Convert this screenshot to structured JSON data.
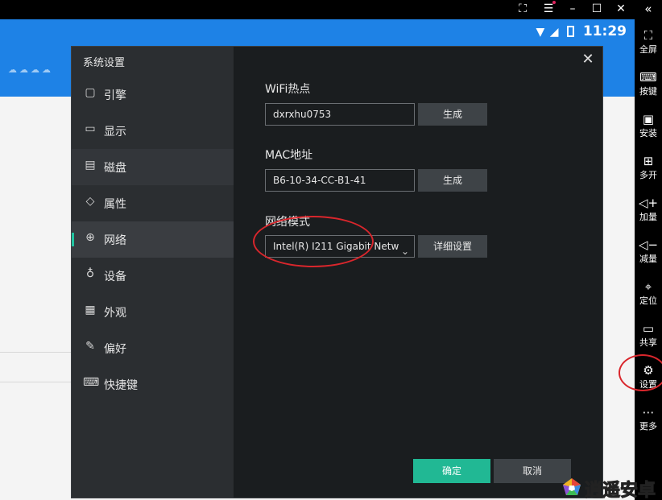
{
  "window_controls": {
    "screenshot": "⛶",
    "menu": "☰",
    "minimize": "–",
    "maximize": "☐",
    "close": "✕",
    "collapse": "«"
  },
  "statusbar": {
    "time": "11:29"
  },
  "right_toolbar": {
    "items": [
      {
        "icon": "⛶",
        "label": "全屏"
      },
      {
        "icon": "⌨",
        "label": "按键"
      },
      {
        "icon": "▣",
        "label": "安装"
      },
      {
        "icon": "⊞",
        "label": "多开"
      },
      {
        "icon": "◁+",
        "label": "加量"
      },
      {
        "icon": "◁−",
        "label": "减量"
      },
      {
        "icon": "⌖",
        "label": "定位"
      },
      {
        "icon": "▭",
        "label": "共享"
      },
      {
        "icon": "⚙",
        "label": "设置"
      },
      {
        "icon": "⋯",
        "label": "更多"
      }
    ]
  },
  "dialog": {
    "title": "系统设置",
    "close": "✕",
    "nav": [
      {
        "icon": "▢",
        "label": "引擎"
      },
      {
        "icon": "▭",
        "label": "显示"
      },
      {
        "icon": "▤",
        "label": "磁盘"
      },
      {
        "icon": "◇",
        "label": "属性"
      },
      {
        "icon": "⊕",
        "label": "网络"
      },
      {
        "icon": "♁",
        "label": "设备"
      },
      {
        "icon": "▦",
        "label": "外观"
      },
      {
        "icon": "✎",
        "label": "偏好"
      },
      {
        "icon": "⌨",
        "label": "快捷键"
      }
    ],
    "wifi": {
      "label": "WiFi热点",
      "value": "dxrxhu0753",
      "button": "生成"
    },
    "mac": {
      "label": "MAC地址",
      "value": "B6-10-34-CC-B1-41",
      "button": "生成"
    },
    "network": {
      "label": "网络模式",
      "value": "Intel(R) I211 Gigabit Netw",
      "button": "详细设置"
    },
    "ok": "确定",
    "cancel": "取消"
  },
  "watermark": {
    "text": "逍遥安卓"
  },
  "colors": {
    "accent": "#21b894",
    "android_blue": "#1e82e6",
    "annotation_red": "#d9262c"
  }
}
